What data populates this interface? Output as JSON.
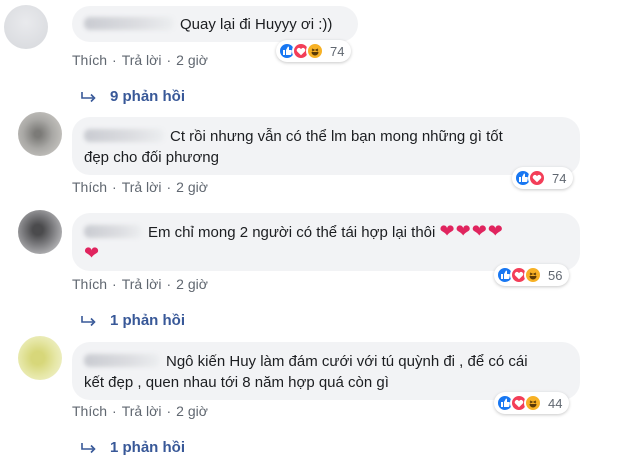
{
  "comments": [
    {
      "text": "Quay lại đi Huyyy ơi :))",
      "actions": {
        "like": "Thích",
        "reply": "Trả lời",
        "time": "2 giờ"
      },
      "reaction_count": "74",
      "reactions": [
        "like-icon",
        "love-icon",
        "haha-icon"
      ],
      "replies": "9 phản hồi"
    },
    {
      "text": "Ct rồi nhưng vẫn có thể lm bạn mong những gì tốt đẹp cho đối phương",
      "line1": "Ct rồi nhưng vẫn có thể lm bạn mong những gì tốt",
      "line2": "đẹp cho đối phương",
      "actions": {
        "like": "Thích",
        "reply": "Trả lời",
        "time": "2 giờ"
      },
      "reaction_count": "74",
      "reactions": [
        "like-icon",
        "love-icon"
      ]
    },
    {
      "text": "Em chỉ mong 2 người có thể tái hợp lại thôi",
      "line1": "Em chỉ mong 2 người có thể tái hợp lại thôi",
      "hearts_line1": "❤❤❤❤",
      "hearts_line2": "❤",
      "actions": {
        "like": "Thích",
        "reply": "Trả lời",
        "time": "2 giờ"
      },
      "reaction_count": "56",
      "reactions": [
        "like-icon",
        "love-icon",
        "haha-icon"
      ],
      "replies": "1 phản hồi"
    },
    {
      "text": "Ngô kiến Huy làm đám cưới với tú quỳnh đi , để có cái kết đẹp , quen nhau tới 8 năm hợp quá còn gì",
      "line1": "Ngô kiến Huy làm đám cưới với tú quỳnh đi , để có cái",
      "line2": "kết đẹp , quen nhau tới 8 năm hợp quá còn gì",
      "actions": {
        "like": "Thích",
        "reply": "Trả lời",
        "time": "2 giờ"
      },
      "reaction_count": "44",
      "reactions": [
        "like-icon",
        "love-icon",
        "haha-icon"
      ],
      "replies": "1 phản hồi"
    }
  ],
  "colors": {
    "bubble": "#f2f3f5",
    "link": "#385898",
    "meta": "#606770",
    "like": "#1877f2",
    "love": "#f33e58",
    "haha": "#f7b125"
  }
}
